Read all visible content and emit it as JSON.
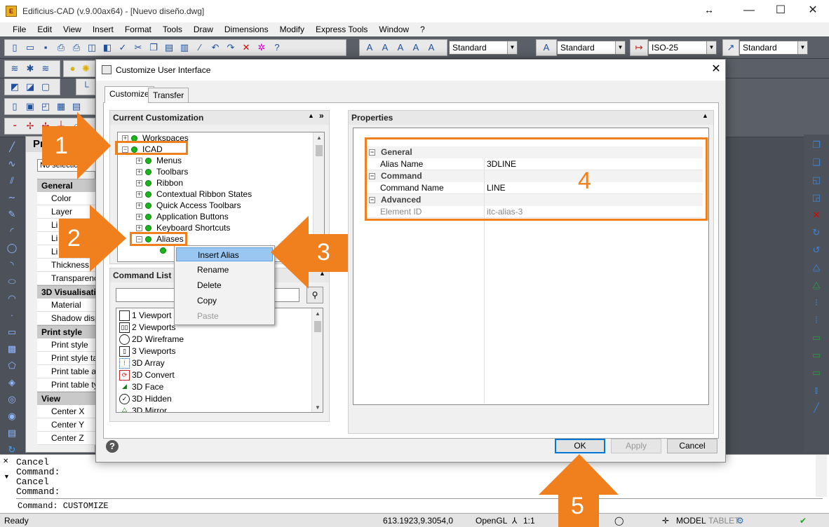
{
  "window": {
    "title": "Edificius-CAD (v.9.00ax64)  - [Nuevo diseño.dwg]",
    "resize_glyph": "↔",
    "minimize": "—",
    "maximize": "☐",
    "close": "✕"
  },
  "menu": [
    "File",
    "Edit",
    "View",
    "Insert",
    "Format",
    "Tools",
    "Draw",
    "Dimensions",
    "Modify",
    "Express Tools",
    "Window",
    "?"
  ],
  "toolbar": {
    "text_style": "Standard",
    "dim_style_text": "Standard",
    "dim_style": "ISO-25",
    "multileader_style": "Standard"
  },
  "properties_palette": {
    "title": "Pr",
    "selection": "No selectio",
    "groups": [
      {
        "label": "General",
        "rows": [
          "Color",
          "Layer",
          "Li",
          "Li",
          "Li",
          "Thickness",
          "Transparency"
        ]
      },
      {
        "label": "3D Visualisati",
        "rows": [
          "Material",
          "Shadow displ"
        ]
      },
      {
        "label": "Print style",
        "rows": [
          "Print style",
          "Print style tab",
          "Print table att",
          "Print table typ"
        ]
      },
      {
        "label": "View",
        "rows": [
          "Center X",
          "Center Y",
          "Center Z"
        ]
      }
    ]
  },
  "dialog": {
    "title": "Customize User Interface",
    "close": "✕",
    "tabs": [
      "Customize",
      "Transfer"
    ],
    "current_customization": {
      "header": "Current Customization",
      "tree": [
        {
          "label": "Workspaces",
          "level": 0,
          "exp": "+"
        },
        {
          "label": "ICAD",
          "level": 0,
          "exp": "−"
        },
        {
          "label": "Menus",
          "level": 1,
          "exp": "+"
        },
        {
          "label": "Toolbars",
          "level": 1,
          "exp": "+"
        },
        {
          "label": "Ribbon",
          "level": 1,
          "exp": "+"
        },
        {
          "label": "Contextual Ribbon States",
          "level": 1,
          "exp": "+"
        },
        {
          "label": "Quick Access Toolbars",
          "level": 1,
          "exp": "+"
        },
        {
          "label": "Application Buttons",
          "level": 1,
          "exp": "+"
        },
        {
          "label": "Keyboard Shortcuts",
          "level": 1,
          "exp": "+"
        },
        {
          "label": "Aliases",
          "level": 1,
          "exp": "−"
        }
      ]
    },
    "command_list": {
      "header": "Command List",
      "search_value": "",
      "items": [
        "1 Viewport",
        "2 Viewports",
        "2D Wireframe",
        "3 Viewports",
        "3D Array",
        "3D Convert",
        "3D Face",
        "3D Hidden",
        "3D Mirror"
      ]
    },
    "properties": {
      "header": "Properties",
      "groups": [
        {
          "label": "General",
          "rows": [
            {
              "key": "Alias Name",
              "value": "3DLINE",
              "dim": false
            }
          ]
        },
        {
          "label": "Command",
          "rows": [
            {
              "key": "Command Name",
              "value": "LINE",
              "dim": false
            }
          ]
        },
        {
          "label": "Advanced",
          "rows": [
            {
              "key": "Element ID",
              "value": "itc-alias-3",
              "dim": true
            }
          ]
        }
      ]
    },
    "context_menu": [
      "Insert Alias",
      "Rename",
      "Delete",
      "Copy",
      "Paste"
    ],
    "buttons": {
      "ok": "OK",
      "apply": "Apply",
      "cancel": "Cancel"
    }
  },
  "command_area": {
    "history": [
      "Cancel",
      "Command:",
      "Cancel",
      "Command:"
    ],
    "current": "Command: CUSTOMIZE"
  },
  "status": {
    "ready": "Ready",
    "coords": "613.1923,9.3054,0",
    "renderer": "OpenGL",
    "scale": "1:1",
    "model": "MODEL",
    "tablet": "TABLET"
  },
  "annotations": [
    "1",
    "2",
    "3",
    "4",
    "5"
  ],
  "colors": {
    "accent": "#f07f1e",
    "tree_dot": "#18b818",
    "highlight": "#9ac7f2",
    "ok_border": "#0078d7"
  }
}
